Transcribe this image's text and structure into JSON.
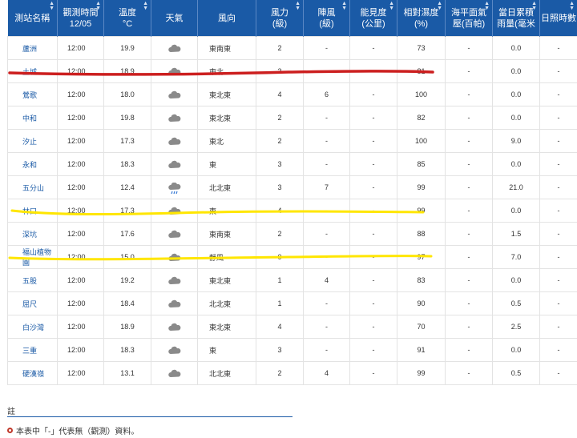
{
  "headers": [
    {
      "label": "測站名稱",
      "sortable": true
    },
    {
      "label": "觀測時間\n12/05",
      "sortable": true
    },
    {
      "label": "溫度\n°C",
      "sortable": true
    },
    {
      "label": "天氣",
      "sortable": false
    },
    {
      "label": "風向",
      "sortable": false
    },
    {
      "label": "風力\n(級)",
      "sortable": true
    },
    {
      "label": "陣風\n(級)",
      "sortable": true
    },
    {
      "label": "能見度\n(公里)",
      "sortable": true
    },
    {
      "label": "相對濕度\n(%)",
      "sortable": true
    },
    {
      "label": "海平面氣\n壓(百帕)",
      "sortable": true
    },
    {
      "label": "當日累積\n雨量(毫米",
      "sortable": true
    },
    {
      "label": "日照時數",
      "sortable": true
    }
  ],
  "rows": [
    {
      "station": "蘆洲",
      "time": "12:00",
      "temp": "19.9",
      "weather": "cloudy-icon",
      "wind_dir": "東南東",
      "wind": "2",
      "gust": "-",
      "vis": "-",
      "rh": "73",
      "pressure": "-",
      "rain": "0.0",
      "sun": "-"
    },
    {
      "station": "土城",
      "time": "12:00",
      "temp": "18.9",
      "weather": "cloudy-icon",
      "wind_dir": "東北",
      "wind": "3",
      "gust": "-",
      "vis": "-",
      "rh": "81",
      "pressure": "-",
      "rain": "0.0",
      "sun": "-"
    },
    {
      "station": "鶯歌",
      "time": "12:00",
      "temp": "18.0",
      "weather": "cloudy-icon",
      "wind_dir": "東北東",
      "wind": "4",
      "gust": "6",
      "vis": "-",
      "rh": "100",
      "pressure": "-",
      "rain": "0.0",
      "sun": "-"
    },
    {
      "station": "中和",
      "time": "12:00",
      "temp": "19.8",
      "weather": "cloudy-icon",
      "wind_dir": "東北東",
      "wind": "2",
      "gust": "-",
      "vis": "-",
      "rh": "82",
      "pressure": "-",
      "rain": "0.0",
      "sun": "-"
    },
    {
      "station": "汐止",
      "time": "12:00",
      "temp": "17.3",
      "weather": "cloudy-icon",
      "wind_dir": "東北",
      "wind": "2",
      "gust": "-",
      "vis": "-",
      "rh": "100",
      "pressure": "-",
      "rain": "9.0",
      "sun": "-"
    },
    {
      "station": "永和",
      "time": "12:00",
      "temp": "18.3",
      "weather": "cloudy-icon",
      "wind_dir": "東",
      "wind": "3",
      "gust": "-",
      "vis": "-",
      "rh": "85",
      "pressure": "-",
      "rain": "0.0",
      "sun": "-"
    },
    {
      "station": "五分山",
      "time": "12:00",
      "temp": "12.4",
      "weather": "rain-cloud-icon",
      "wind_dir": "北北東",
      "wind": "3",
      "gust": "7",
      "vis": "-",
      "rh": "99",
      "pressure": "-",
      "rain": "21.0",
      "sun": "-"
    },
    {
      "station": "林口",
      "time": "12:00",
      "temp": "17.3",
      "weather": "cloudy-icon",
      "wind_dir": "東",
      "wind": "4",
      "gust": "-",
      "vis": "-",
      "rh": "99",
      "pressure": "-",
      "rain": "0.0",
      "sun": "-"
    },
    {
      "station": "深坑",
      "time": "12:00",
      "temp": "17.6",
      "weather": "cloudy-icon",
      "wind_dir": "東南東",
      "wind": "2",
      "gust": "-",
      "vis": "-",
      "rh": "88",
      "pressure": "-",
      "rain": "1.5",
      "sun": "-"
    },
    {
      "station": "福山植物園",
      "time": "12:00",
      "temp": "15.0",
      "weather": "cloudy-icon",
      "wind_dir": "靜風",
      "wind": "0",
      "gust": "-",
      "vis": "-",
      "rh": "97",
      "pressure": "-",
      "rain": "7.0",
      "sun": "-"
    },
    {
      "station": "五股",
      "time": "12:00",
      "temp": "19.2",
      "weather": "cloudy-icon",
      "wind_dir": "東北東",
      "wind": "1",
      "gust": "4",
      "vis": "-",
      "rh": "83",
      "pressure": "-",
      "rain": "0.0",
      "sun": "-"
    },
    {
      "station": "屈尺",
      "time": "12:00",
      "temp": "18.4",
      "weather": "cloudy-icon",
      "wind_dir": "北北東",
      "wind": "1",
      "gust": "-",
      "vis": "-",
      "rh": "90",
      "pressure": "-",
      "rain": "0.5",
      "sun": "-"
    },
    {
      "station": "白沙灣",
      "time": "12:00",
      "temp": "18.9",
      "weather": "cloudy-icon",
      "wind_dir": "東北東",
      "wind": "4",
      "gust": "-",
      "vis": "-",
      "rh": "70",
      "pressure": "-",
      "rain": "2.5",
      "sun": "-"
    },
    {
      "station": "三重",
      "time": "12:00",
      "temp": "18.3",
      "weather": "cloudy-icon",
      "wind_dir": "東",
      "wind": "3",
      "gust": "-",
      "vis": "-",
      "rh": "91",
      "pressure": "-",
      "rain": "0.0",
      "sun": "-"
    },
    {
      "station": "硬漢嶺",
      "time": "12:00",
      "temp": "13.1",
      "weather": "cloudy-icon",
      "wind_dir": "北北東",
      "wind": "2",
      "gust": "4",
      "vis": "-",
      "rh": "99",
      "pressure": "-",
      "rain": "0.5",
      "sun": "-"
    }
  ],
  "note": {
    "title": "註",
    "text": "本表中「-」代表無（觀測）資料。"
  },
  "colors": {
    "header_bg": "#1a5aa6",
    "link": "#1a5aa6",
    "red_highlight": "#cc1f1f",
    "yellow_highlight": "#ffe600"
  }
}
